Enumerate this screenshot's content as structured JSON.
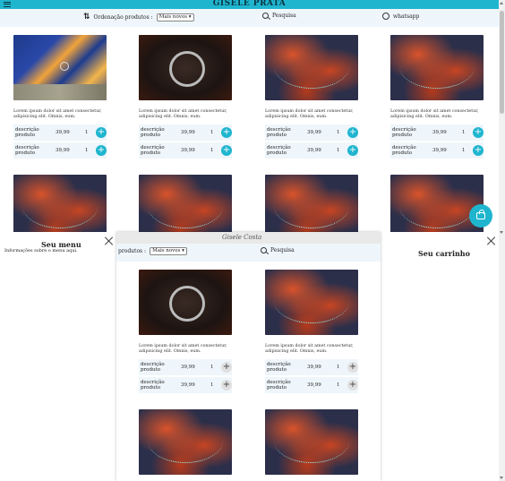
{
  "brand": "GISELE PRATA",
  "filter": {
    "sort_label": "Ordenação produtos :",
    "sort_value": "Mais novos",
    "search_label": "Pesquisa",
    "whatsapp_label": "whatsapp"
  },
  "description": "Lorem ipsum dolor sit amet consectetur, adipisicing elit. Omnis, eum.",
  "row_label": "descrição produto",
  "price": "39,99",
  "qty": "1",
  "plus": "+",
  "menu": {
    "title": "Seu menu",
    "info": "Informações sobre o menu aqui."
  },
  "cart": {
    "title": "Seu carrinho"
  },
  "popup": {
    "signature": "Gisele Costa",
    "sort_label": "produtos :",
    "sort_value": "Mais novos",
    "search_label": "Pesquisa"
  },
  "colors": {
    "accent": "#1fb5cf",
    "filter_bg": "#eef6fb"
  }
}
